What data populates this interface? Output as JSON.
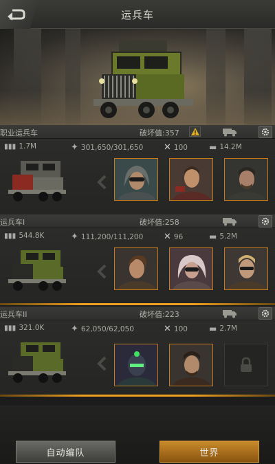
{
  "header": {
    "title": "运兵车",
    "back_icon": "back-arrow-icon"
  },
  "squads": [
    {
      "name": "职业运兵车",
      "damage": "破坏值:357",
      "has_warning": true,
      "stats": {
        "troops": "1.7M",
        "power": "301,650/301,650",
        "repair": "100",
        "load": "14.2M"
      },
      "slots": [
        "hero",
        "hero",
        "hero"
      ]
    },
    {
      "name": "运兵车I",
      "damage": "破坏值:258",
      "has_warning": false,
      "stats": {
        "troops": "544.8K",
        "power": "111,200/111,200",
        "repair": "96",
        "load": "5.2M"
      },
      "slots": [
        "hero",
        "hero",
        "hero"
      ]
    },
    {
      "name": "运兵车II",
      "damage": "破坏值:223",
      "has_warning": false,
      "stats": {
        "troops": "321.0K",
        "power": "62,050/62,050",
        "repair": "100",
        "load": "2.7M"
      },
      "slots": [
        "hero",
        "hero",
        "locked"
      ]
    }
  ],
  "footer": {
    "auto_button": "自动编队",
    "world_button": "世界"
  },
  "colors": {
    "accent": "#f0a020",
    "slot_border": "#c77a1a",
    "panel": "#2d2d2b"
  }
}
